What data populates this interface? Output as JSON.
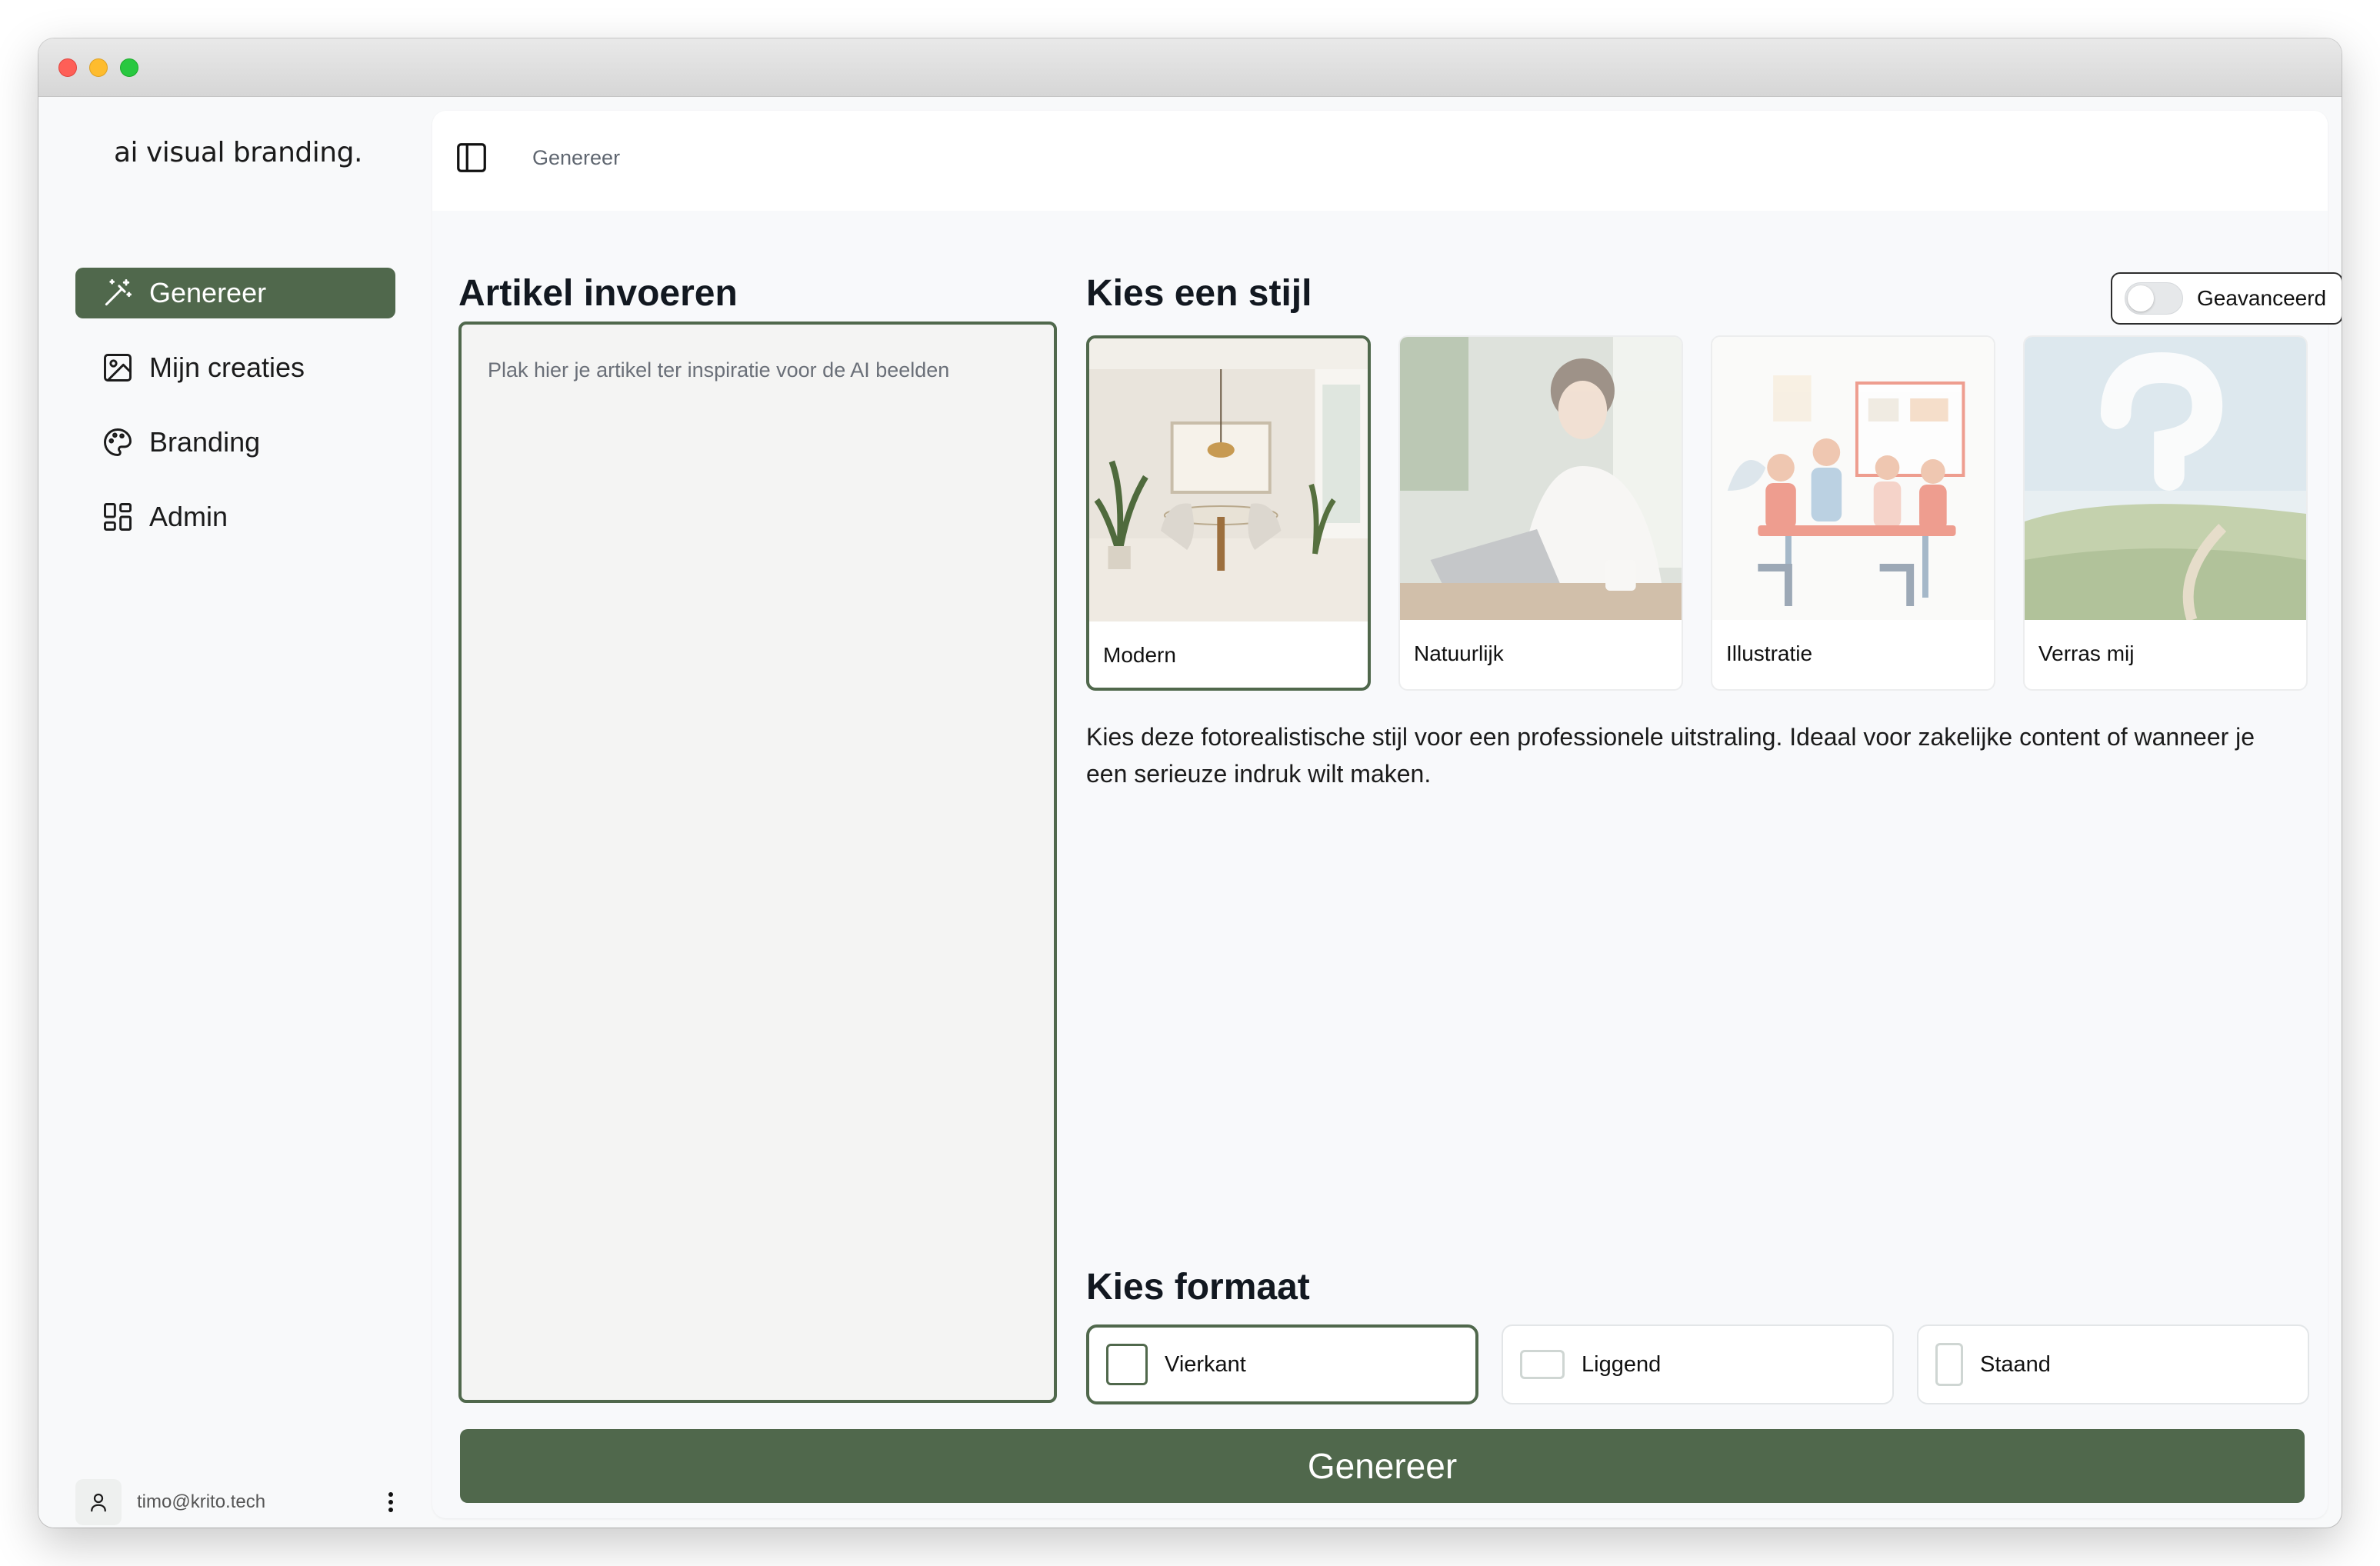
{
  "brand": "ai visual branding.",
  "sidebar": {
    "items": [
      {
        "label": "Genereer",
        "icon": "magic-wand-icon",
        "active": true
      },
      {
        "label": "Mijn creaties",
        "icon": "image-icon",
        "active": false
      },
      {
        "label": "Branding",
        "icon": "palette-icon",
        "active": false
      },
      {
        "label": "Admin",
        "icon": "dashboard-grid-icon",
        "active": false
      }
    ],
    "user_email": "timo@krito.tech"
  },
  "header": {
    "breadcrumb": "Genereer"
  },
  "article": {
    "title": "Artikel invoeren",
    "placeholder": "Plak hier je artikel ter inspiratie voor de AI beelden",
    "value": ""
  },
  "style": {
    "title": "Kies een stijl",
    "advanced_label": "Geavanceerd",
    "advanced_enabled": false,
    "cards": [
      {
        "label": "Modern",
        "selected": true
      },
      {
        "label": "Natuurlijk",
        "selected": false
      },
      {
        "label": "Illustratie",
        "selected": false
      },
      {
        "label": "Verras mij",
        "selected": false
      }
    ],
    "description": "Kies deze fotorealistische stijl voor een professionele uitstraling. Ideaal voor zakelijke content of wanneer je een serieuze indruk wilt maken."
  },
  "format": {
    "title": "Kies formaat",
    "options": [
      {
        "label": "Vierkant",
        "selected": true
      },
      {
        "label": "Liggend",
        "selected": false
      },
      {
        "label": "Staand",
        "selected": false
      }
    ]
  },
  "generate_label": "Genereer",
  "colors": {
    "accent": "#50684c",
    "page_bg": "#f8f9fa",
    "text": "#121820"
  }
}
